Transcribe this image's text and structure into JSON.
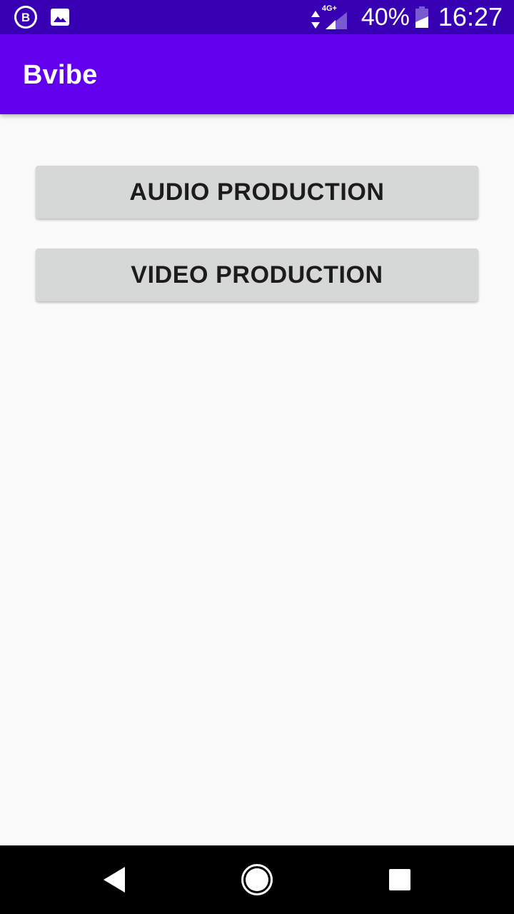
{
  "status_bar": {
    "left_icons": [
      "b-badge-icon",
      "image-icon"
    ],
    "b_icon_letter": "B",
    "network_type": "4G+",
    "battery_percent": "40%",
    "time": "16:27"
  },
  "app_bar": {
    "title": "Bvibe"
  },
  "main": {
    "buttons": [
      {
        "label": "AUDIO PRODUCTION"
      },
      {
        "label": "VIDEO PRODUCTION"
      }
    ]
  },
  "nav_bar": {
    "icons": [
      "back-icon",
      "home-icon",
      "recents-icon"
    ]
  },
  "colors": {
    "status_bar": "#3700b3",
    "app_bar": "#6200ee",
    "background": "#fafafa",
    "button": "#d6d7d7",
    "button_text": "#1c1c1c",
    "nav_bar": "#000000"
  }
}
